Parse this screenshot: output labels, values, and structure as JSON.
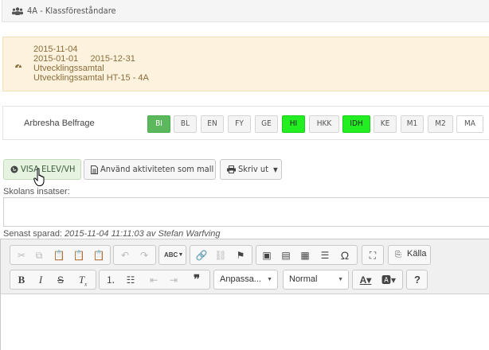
{
  "header": {
    "title": "4A - Klassföreståndare",
    "icon": "users-icon"
  },
  "info": {
    "icon": "dashboard-icon",
    "lines": [
      "2015-11-04",
      "2015-01-01     2015-12-31",
      "Utvecklingssamtal",
      "Utvecklingssamtal HT-15 - 4A"
    ]
  },
  "student": {
    "name": "Arbresha Belfrage",
    "subjects": [
      {
        "code": "BI",
        "state": "dark-green"
      },
      {
        "code": "BL",
        "state": "default"
      },
      {
        "code": "EN",
        "state": "default"
      },
      {
        "code": "FY",
        "state": "default"
      },
      {
        "code": "GE",
        "state": "default"
      },
      {
        "code": "HI",
        "state": "green"
      },
      {
        "code": "HKK",
        "state": "default"
      },
      {
        "code": "IDH",
        "state": "green"
      },
      {
        "code": "KE",
        "state": "default"
      },
      {
        "code": "M1",
        "state": "default"
      },
      {
        "code": "M2",
        "state": "default"
      },
      {
        "code": "MA",
        "state": "white"
      }
    ]
  },
  "actions": {
    "show_student": "VISA ELEV/VH",
    "use_template": "Använd aktiviteten som mall",
    "print": "Skriv ut"
  },
  "form": {
    "insatser_label": "Skolans insatser:",
    "saved_prefix": "Senast sparad:",
    "saved_value": "2015-11-04 11:11:03 av Stefan Warfving"
  },
  "editor": {
    "source_label": "Källa",
    "styles_value": "Anpassa...",
    "format_value": "Normal",
    "bold": "B",
    "italic": "I",
    "strike": "S",
    "help": "?"
  },
  "colors": {
    "dark_green": "#5cb85c",
    "bright_green": "#22ee22",
    "info_bg": "#fcf2dd"
  }
}
